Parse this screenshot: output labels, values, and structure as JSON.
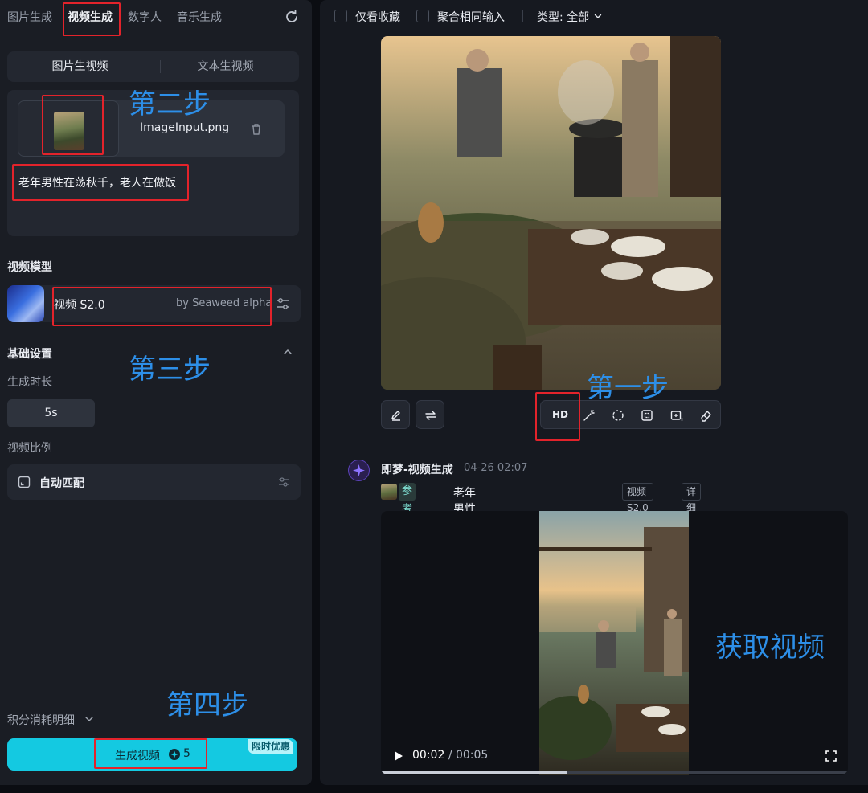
{
  "left_nav": {
    "tabs": [
      "图片生成",
      "视频生成",
      "数字人",
      "音乐生成"
    ],
    "active_tab": "视频生成"
  },
  "mode_switch": {
    "options": [
      "图片生视频",
      "文本生视频"
    ],
    "selected": "图片生视频"
  },
  "upload": {
    "file_name": "ImageInput.png"
  },
  "prompt": {
    "text": "老年男性在荡秋千，老人在做饭"
  },
  "video_model": {
    "section_label": "视频模型",
    "name": "视频 S2.0",
    "provider": "by Seaweed alpha"
  },
  "basic_settings": {
    "section_label": "基础设置",
    "duration_label": "生成时长",
    "duration_value": "5s",
    "ratio_label": "视频比例",
    "ratio_value": "自动匹配"
  },
  "cost_detail_label": "积分消耗明细",
  "generate": {
    "label": "生成视频",
    "cost": "5",
    "promo_badge": "限时优惠",
    "accent": "#14c9e1"
  },
  "filters": {
    "favorites_only": "仅看收藏",
    "merge_same_input": "聚合相同输入",
    "type_label": "类型: 全部"
  },
  "image_tools": [
    "edit-icon",
    "regenerate-icon",
    "HD",
    "magic-wand-icon",
    "remix-icon",
    "expand-icon",
    "add-frame-icon",
    "eraser-icon"
  ],
  "image_tools_hd_label": "HD",
  "job": {
    "title": "即梦-视频生成",
    "time": "04-26  02:07",
    "ref_tag": "参考首帧",
    "prompt": "老年男性在荡秋千，老人在做饭",
    "model_pill": "视频 S2.0",
    "details_pill": "详细信息"
  },
  "player": {
    "current": "00:02",
    "separator": "/",
    "total": "00:05",
    "progress": 0.4
  },
  "annotations": {
    "step1": "第一步",
    "step2": "第二步",
    "step3": "第三步",
    "step4": "第四步",
    "get_video": "获取视频",
    "color": "#2d8fe8",
    "highlight_color": "#e3232b"
  }
}
